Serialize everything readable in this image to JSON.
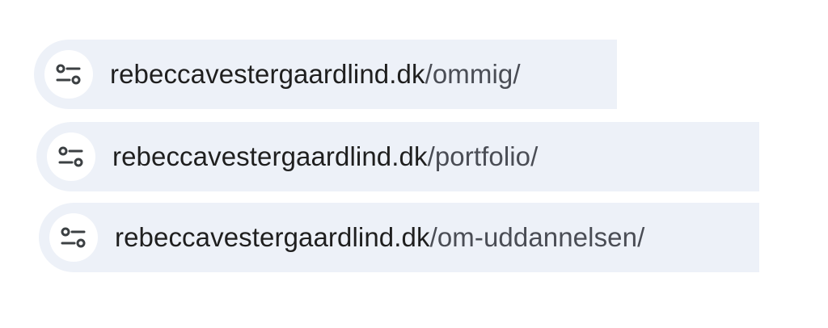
{
  "items": [
    {
      "domain": "rebeccavestergaardlind.dk",
      "path": "/ommig/",
      "icon": "tune-settings-icon"
    },
    {
      "domain": "rebeccavestergaardlind.dk",
      "path": "/portfolio/",
      "icon": "tune-settings-icon"
    },
    {
      "domain": "rebeccavestergaardlind.dk",
      "path": "/om-uddannelsen/",
      "icon": "tune-settings-icon"
    }
  ],
  "colors": {
    "bar_background": "#edf1f8",
    "domain_text": "#1f1f1f",
    "path_text": "#4a4d55",
    "icon_stroke": "#3c4043"
  }
}
